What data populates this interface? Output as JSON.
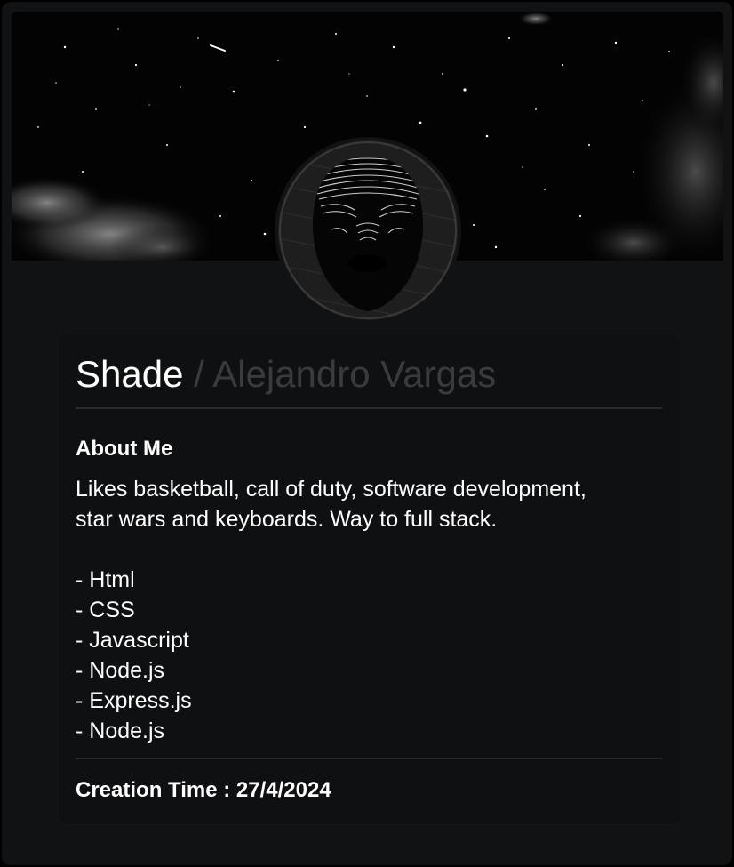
{
  "profile": {
    "display_name": "Shade",
    "separator": "/",
    "user_name": "Alejandro Vargas"
  },
  "about": {
    "title": "About Me",
    "bio_line1": "Likes basketball, call of duty, software development,",
    "bio_line2": "star wars and keyboards. Way to full stack.",
    "skills": [
      "- Html",
      "- CSS",
      "- Javascript",
      "- Node.js",
      "- Express.js",
      "- Node.js"
    ]
  },
  "footer": {
    "creation_label": "Creation Time : 27/4/2024"
  },
  "colors": {
    "page_background": "#000000",
    "card_background": "#111214",
    "muted_text": "#3a3b3f",
    "primary_text": "#ffffff"
  },
  "images": {
    "banner": "starry-night-sky",
    "avatar": "face-line-art"
  }
}
